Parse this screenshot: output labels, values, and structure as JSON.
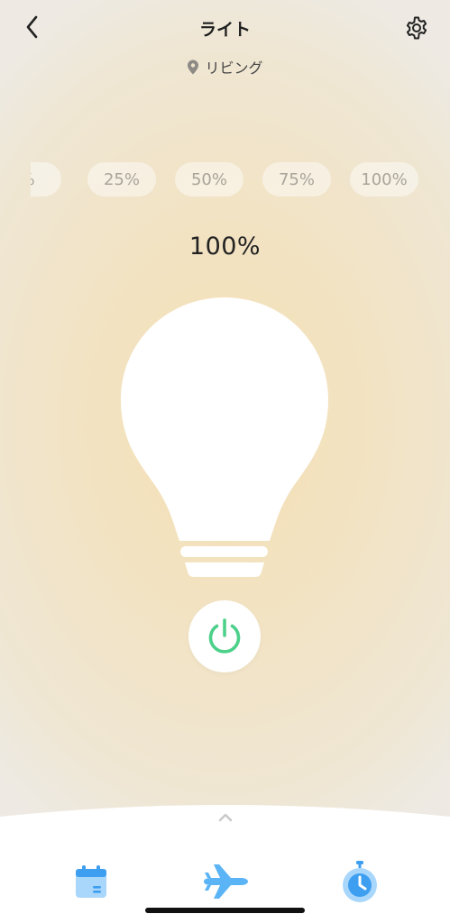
{
  "header": {
    "title": "ライト",
    "back_icon": "chevron-left-icon",
    "settings_icon": "gear-icon"
  },
  "location": {
    "icon": "location-pin-icon",
    "label": "リビング"
  },
  "presets": [
    {
      "label": "%"
    },
    {
      "label": "25%"
    },
    {
      "label": "50%"
    },
    {
      "label": "75%"
    },
    {
      "label": "100%"
    }
  ],
  "brightness": {
    "label": "100%",
    "value_percent": 100
  },
  "power": {
    "icon": "power-icon",
    "color": "#4cd08a"
  },
  "bottom_bar": {
    "handle_icon": "chevron-up-icon",
    "tabs": [
      {
        "icon": "calendar-icon"
      },
      {
        "icon": "airplane-icon"
      },
      {
        "icon": "stopwatch-icon"
      }
    ]
  },
  "colors": {
    "accent_blue": "#5ab4f5",
    "bulb": "#ffffff",
    "background_warm": "#f4dfb3"
  }
}
